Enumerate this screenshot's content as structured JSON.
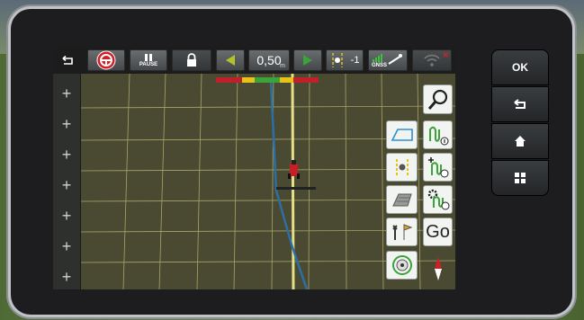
{
  "device": {
    "hw_buttons": [
      {
        "name": "ok",
        "label": "OK"
      },
      {
        "name": "back",
        "icon": "return-icon"
      },
      {
        "name": "home",
        "icon": "home-icon"
      },
      {
        "name": "apps",
        "icon": "grid-icon"
      }
    ]
  },
  "topbar": {
    "pause_label": "PAUSE",
    "working_width": "0,50",
    "working_width_unit": "m",
    "track_number": "-1",
    "gnss_label": "GNSS"
  },
  "colors": {
    "track_line": "#e4e08a",
    "guide_line": "#2c6fa4",
    "field_lines": "#c8c27a",
    "map_bg": "#4a4a32"
  },
  "side_panel": {
    "go_label": "Go"
  },
  "lightbar_colors": [
    "#c0202a",
    "#c0202a",
    "#e6c21a",
    "#3aa33a",
    "#3aa33a",
    "#e6c21a",
    "#c0202a",
    "#c0202a"
  ]
}
